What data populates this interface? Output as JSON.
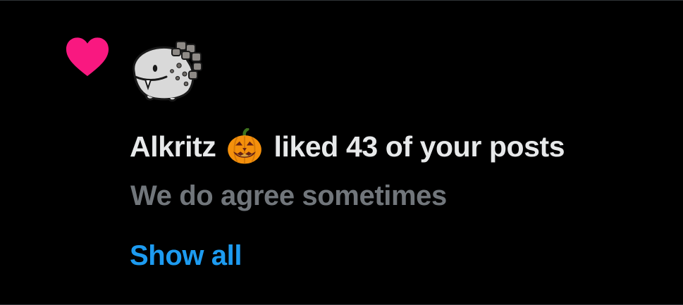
{
  "notification": {
    "type_icon": "heart-icon",
    "avatar_icon": "monster-avatar",
    "actor_name": "Alkritz",
    "actor_emoji": "🎃",
    "action_text": "liked 43 of your posts",
    "post_preview": "We do agree sometimes",
    "show_all_label": "Show all"
  },
  "colors": {
    "background": "#000000",
    "primary_text": "#e7e9ea",
    "secondary_text": "#71767b",
    "link": "#1d9bf0",
    "heart": "#f91880",
    "divider": "#2f3336"
  }
}
